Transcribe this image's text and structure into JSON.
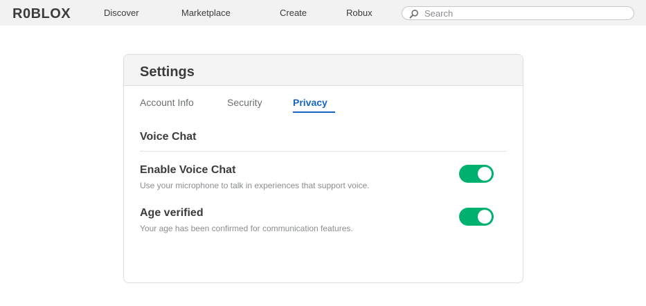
{
  "topbar": {
    "logo": "R0BLOX",
    "nav": {
      "discover": "Discover",
      "marketplace": "Marketplace",
      "create": "Create",
      "robux": "Robux"
    },
    "search": {
      "placeholder": "Search",
      "value": "",
      "icon": "search-icon"
    }
  },
  "settings": {
    "title": "Settings",
    "tabs": [
      {
        "label": "Account Info",
        "active": false
      },
      {
        "label": "Security",
        "active": false
      },
      {
        "label": "Privacy",
        "active": true
      }
    ],
    "section": {
      "title": "Voice Chat",
      "items": [
        {
          "title": "Enable Voice Chat",
          "description": "Use your microphone to talk in experiences that support voice.",
          "enabled": true
        },
        {
          "title": "Age verified",
          "description": "Your age has been confirmed for communication features.",
          "enabled": true
        }
      ]
    }
  },
  "colors": {
    "accent": "#1565c0",
    "toggle_on": "#00b06f",
    "topbar_bg": "#f2f2f3",
    "text": "#393b3d",
    "muted": "#8a8d90"
  }
}
